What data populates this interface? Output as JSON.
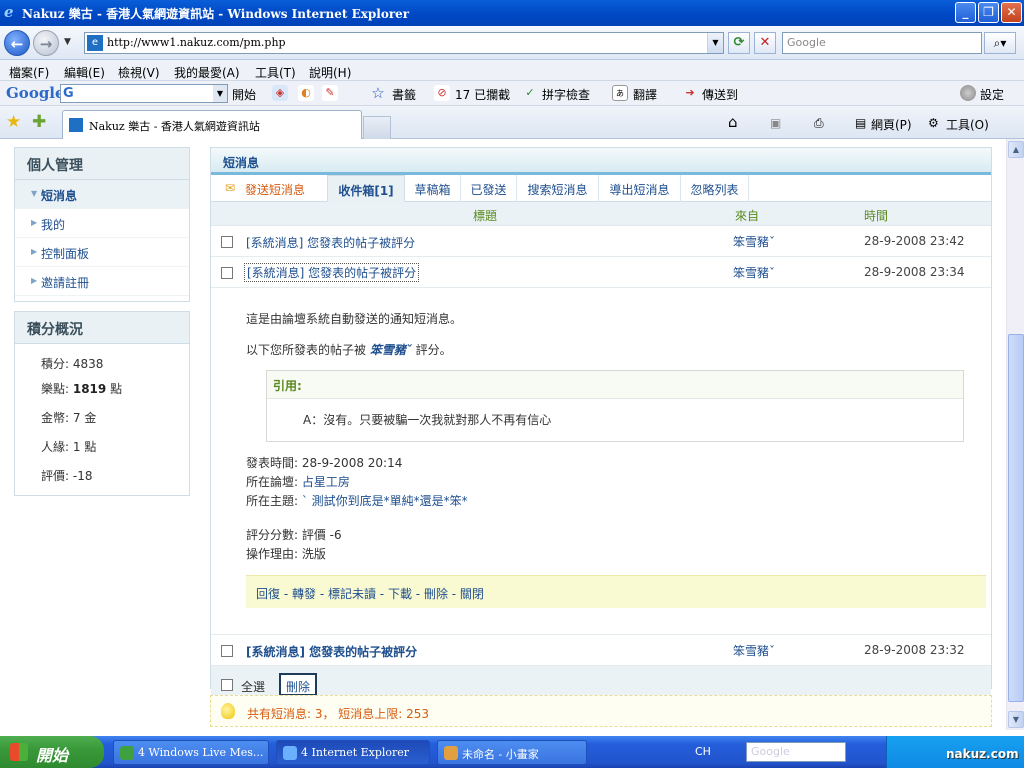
{
  "window": {
    "title": "Nakuz 樂古 - 香港人氣網遊資訊站 - Windows Internet Explorer",
    "url": "http://www1.nakuz.com/pm.php",
    "search_placeholder": "Google"
  },
  "menu": [
    "檔案(F)",
    "編輯(E)",
    "檢視(V)",
    "我的最愛(A)",
    "工具(T)",
    "說明(H)"
  ],
  "google_toolbar": {
    "logo": "Google",
    "g": "G",
    "start": "開始",
    "bookmarks": "書籤",
    "blocked": "17 已攔截",
    "spellcheck": "拼字檢查",
    "translate": "翻譯",
    "sendto": "傳送到",
    "settings": "設定"
  },
  "tab_bar": {
    "tab_label": "Nakuz 樂古 - 香港人氣網遊資訊站",
    "page_menu": "網頁(P)",
    "tools_menu": "工具(O)"
  },
  "sidebar": {
    "title": "個人管理",
    "items": [
      {
        "label": "短消息"
      },
      {
        "label": "我的"
      },
      {
        "label": "控制面板"
      },
      {
        "label": "邀請註冊"
      }
    ],
    "points_title": "積分概況",
    "stats": [
      {
        "label": "積分: ",
        "value": "4838",
        "unit": ""
      },
      {
        "label": "樂點: ",
        "value": "1819",
        "unit": " 點"
      },
      {
        "label": "金幣: ",
        "value": "7",
        "unit": " 金"
      },
      {
        "label": "人緣: ",
        "value": "1",
        "unit": " 點"
      },
      {
        "label": "評價: ",
        "value": "-18",
        "unit": ""
      }
    ]
  },
  "pm": {
    "header": "短消息",
    "tabs": [
      "發送短消息",
      "收件箱[1]",
      "草稿箱",
      "已發送",
      "搜索短消息",
      "導出短消息",
      "忽略列表"
    ],
    "columns": {
      "subject": "標題",
      "from": "來自",
      "time": "時間"
    },
    "messages": [
      {
        "subject": "[系統消息] 您發表的帖子被評分",
        "from": "笨雪豬ˇ",
        "time": "28-9-2008 23:42"
      },
      {
        "subject": "[系統消息] 您發表的帖子被評分",
        "from": "笨雪豬ˇ",
        "time": "28-9-2008 23:34"
      },
      {
        "subject": "[系統消息] 您發表的帖子被評分",
        "from": "笨雪豬ˇ",
        "time": "28-9-2008 23:32"
      }
    ],
    "detail": {
      "line1": "這是由論壇系統自動發送的通知短消息。",
      "line2_pre": "以下您所發表的帖子被 ",
      "line2_user": "笨雪豬ˇ",
      "line2_post": " 評分。",
      "quote_title": "引用:",
      "quote_body": "A：沒有。只要被騙一次我就對那人不再有信心",
      "posted_label": "發表時間: ",
      "posted_value": "28-9-2008 20:14",
      "forum_label": "所在論壇: ",
      "forum_value": "占星工房",
      "thread_label": "所在主題: ",
      "thread_value": "` 測試你到底是*單純*還是*笨*",
      "score_label": "評分分數: ",
      "score_value": "評價 -6",
      "reason_label": "操作理由: ",
      "reason_value": "洗版",
      "actions": [
        "回復",
        "轉發",
        "標記未讀",
        "下載",
        "刪除",
        "關閉"
      ]
    },
    "select_all": "全選",
    "delete_button": "刪除",
    "info": "共有短消息: 3， 短消息上限: 253"
  },
  "taskbar": {
    "start": "開始",
    "tasks": [
      "4 Windows Live Mes...",
      "4 Internet Explorer",
      "未命名 - 小畫家"
    ],
    "lang": "CH",
    "search_placeholder": "Google",
    "watermark": "nakuz.com"
  }
}
